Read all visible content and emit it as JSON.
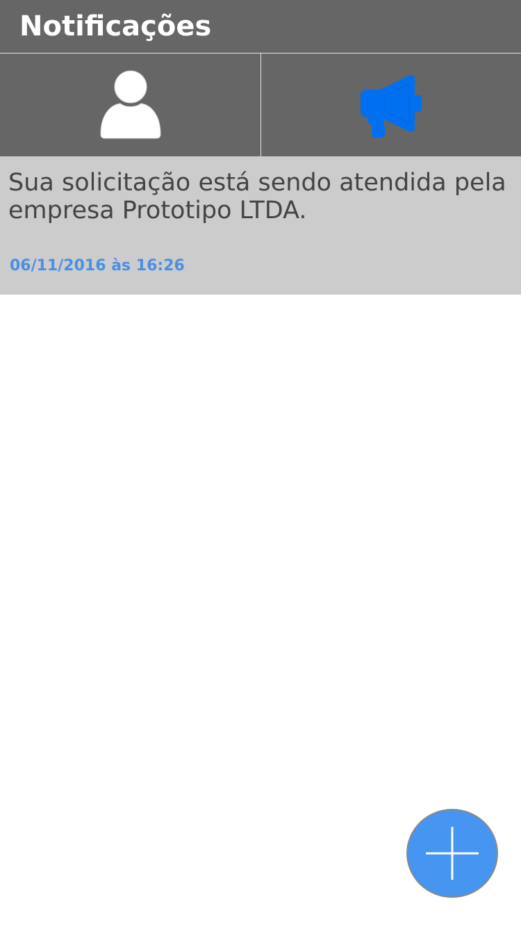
{
  "header": {
    "title": "Notificações"
  },
  "tabs": [
    {
      "icon": "user-icon",
      "active": false,
      "icon_color": "#ffffff"
    },
    {
      "icon": "megaphone-icon",
      "active": true,
      "icon_color": "#0070f0"
    }
  ],
  "notifications": [
    {
      "text": "Sua solicitação está sendo atendida pela empresa Prototipo LTDA.",
      "date": "06/11/2016 às 16:26"
    }
  ],
  "fab": {
    "icon": "plus-icon",
    "color": "#4695f0"
  },
  "colors": {
    "header_bg": "#666666",
    "notification_bg": "#cccccc",
    "date_text": "#4a90e2",
    "accent": "#0070f0"
  }
}
